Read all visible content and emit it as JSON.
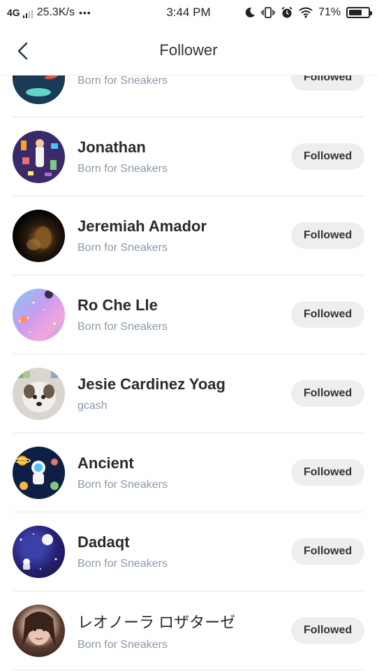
{
  "status_bar": {
    "network": "4G",
    "speed": "25.3K/s",
    "more": "•••",
    "time": "3:44 PM",
    "battery": "71%",
    "battery_level": 0.71
  },
  "header": {
    "title": "Follower"
  },
  "followers": [
    {
      "name": "",
      "bio": "Born for Sneakers",
      "button": "Followed"
    },
    {
      "name": "Jonathan",
      "bio": "Born for Sneakers",
      "button": "Followed"
    },
    {
      "name": "Jeremiah Amador",
      "bio": "Born for Sneakers",
      "button": "Followed"
    },
    {
      "name": "Ro Che Lle",
      "bio": "Born for Sneakers",
      "button": "Followed"
    },
    {
      "name": "Jesie Cardinez Yoag",
      "bio": "gcash",
      "button": "Followed"
    },
    {
      "name": "Ancient",
      "bio": "Born for Sneakers",
      "button": "Followed"
    },
    {
      "name": "Dadaqt",
      "bio": "Born for Sneakers",
      "button": "Followed"
    },
    {
      "name": "レオノーラ ロザターゼ",
      "bio": "Born for Sneakers",
      "button": "Followed"
    }
  ]
}
